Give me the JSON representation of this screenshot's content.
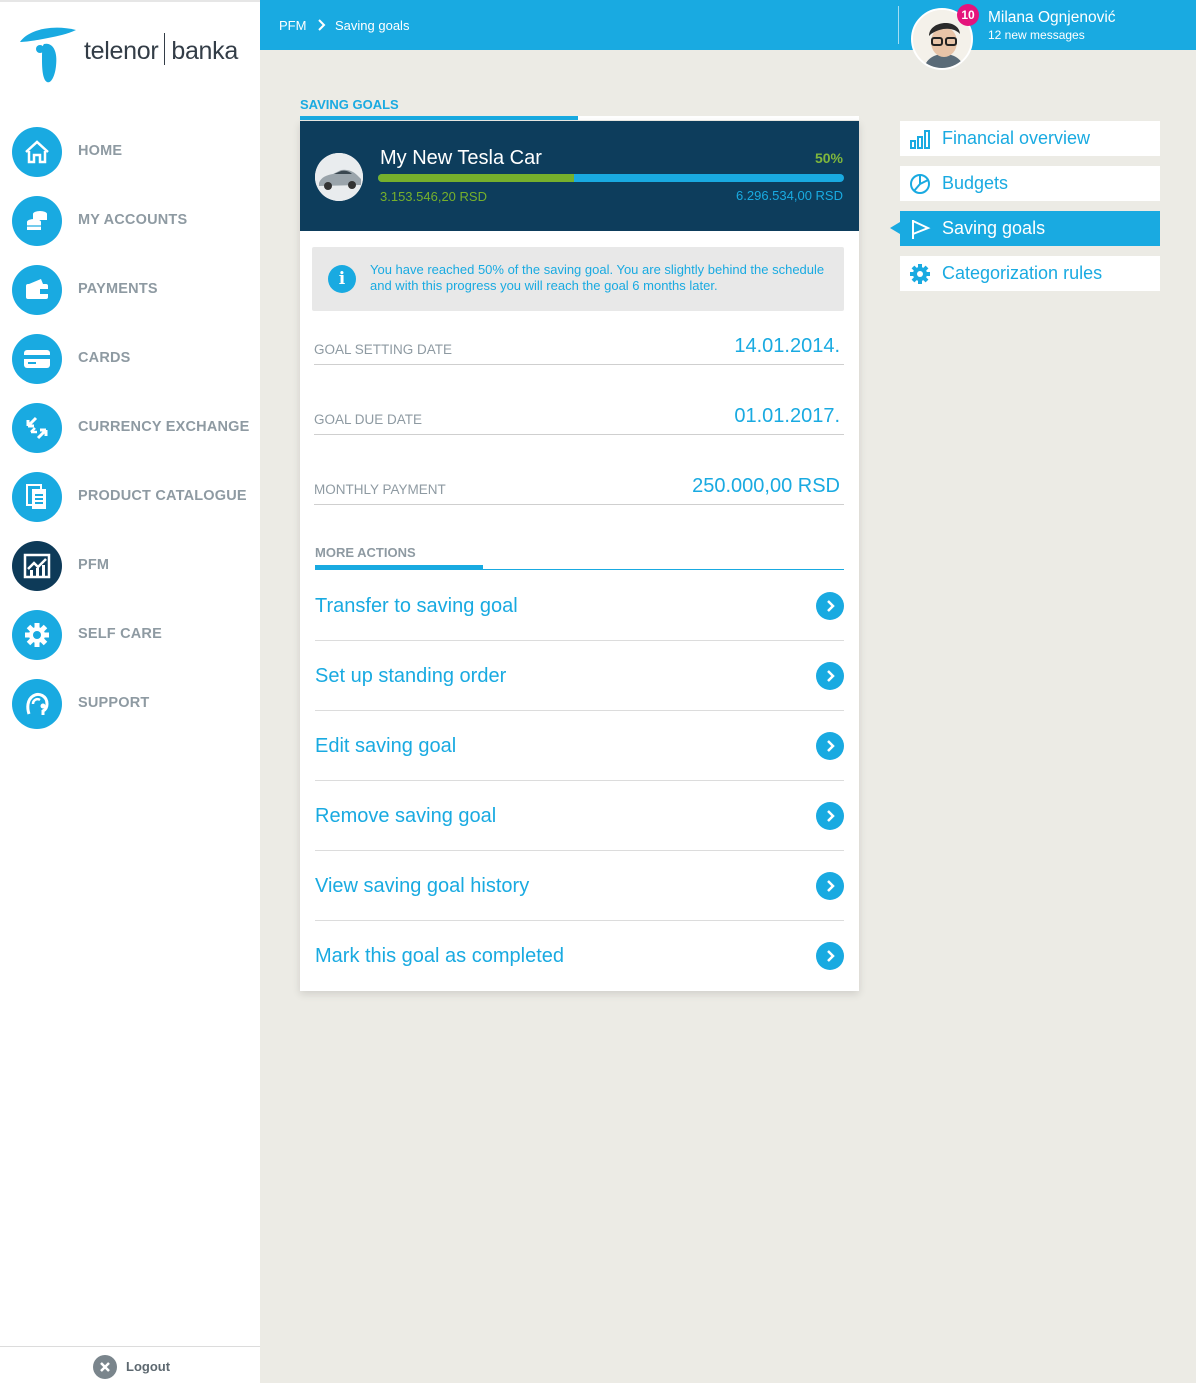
{
  "brand": {
    "name_left": "telenor",
    "name_right": "banka",
    "accent": "#19aae1",
    "dark": "#0d3d5c",
    "green": "#76b02c"
  },
  "sidebar": {
    "items": [
      {
        "label": "HOME",
        "icon": "home-icon"
      },
      {
        "label": "MY ACCOUNTS",
        "icon": "coins-icon"
      },
      {
        "label": "PAYMENTS",
        "icon": "wallet-icon"
      },
      {
        "label": "CARDS",
        "icon": "card-icon"
      },
      {
        "label": "CURRENCY EXCHANGE",
        "icon": "exchange-icon"
      },
      {
        "label": "PRODUCT CATALOGUE",
        "icon": "catalogue-icon"
      },
      {
        "label": "PFM",
        "icon": "chart-icon",
        "active": true
      },
      {
        "label": "SELF CARE",
        "icon": "gear-icon"
      },
      {
        "label": "SUPPORT",
        "icon": "headset-icon"
      }
    ],
    "logout_label": "Logout"
  },
  "header": {
    "breadcrumb": [
      "PFM",
      "Saving goals"
    ],
    "user_name": "Milana Ognjenović",
    "user_messages": "12 new messages",
    "badge_count": "10"
  },
  "section": {
    "title": "SAVING GOALS"
  },
  "goal": {
    "title": "My New Tesla Car",
    "percent_label": "50%",
    "progress": 0.42,
    "saved": "3.153.546,20 RSD",
    "target": "6.296.534,00 RSD",
    "info": "You have reached 50% of the saving goal. You are slightly behind the schedule and with this progress you will reach the goal 6 months later."
  },
  "fields": [
    {
      "label": "GOAL SETTING DATE",
      "value": "14.01.2014."
    },
    {
      "label": "GOAL DUE DATE",
      "value": "01.01.2017."
    },
    {
      "label": "MONTHLY PAYMENT",
      "value": "250.000,00 RSD"
    }
  ],
  "more_actions": {
    "title": "MORE ACTIONS",
    "items": [
      "Transfer to saving goal",
      "Set up standing order",
      "Edit saving goal",
      "Remove saving goal",
      "View saving goal history",
      "Mark this goal as completed"
    ]
  },
  "right_menu": {
    "items": [
      {
        "label": "Financial overview",
        "icon": "bar-chart-icon"
      },
      {
        "label": "Budgets",
        "icon": "pie-chart-icon"
      },
      {
        "label": "Saving goals",
        "icon": "flag-icon",
        "active": true
      },
      {
        "label": "Categorization rules",
        "icon": "gear-icon"
      }
    ]
  }
}
